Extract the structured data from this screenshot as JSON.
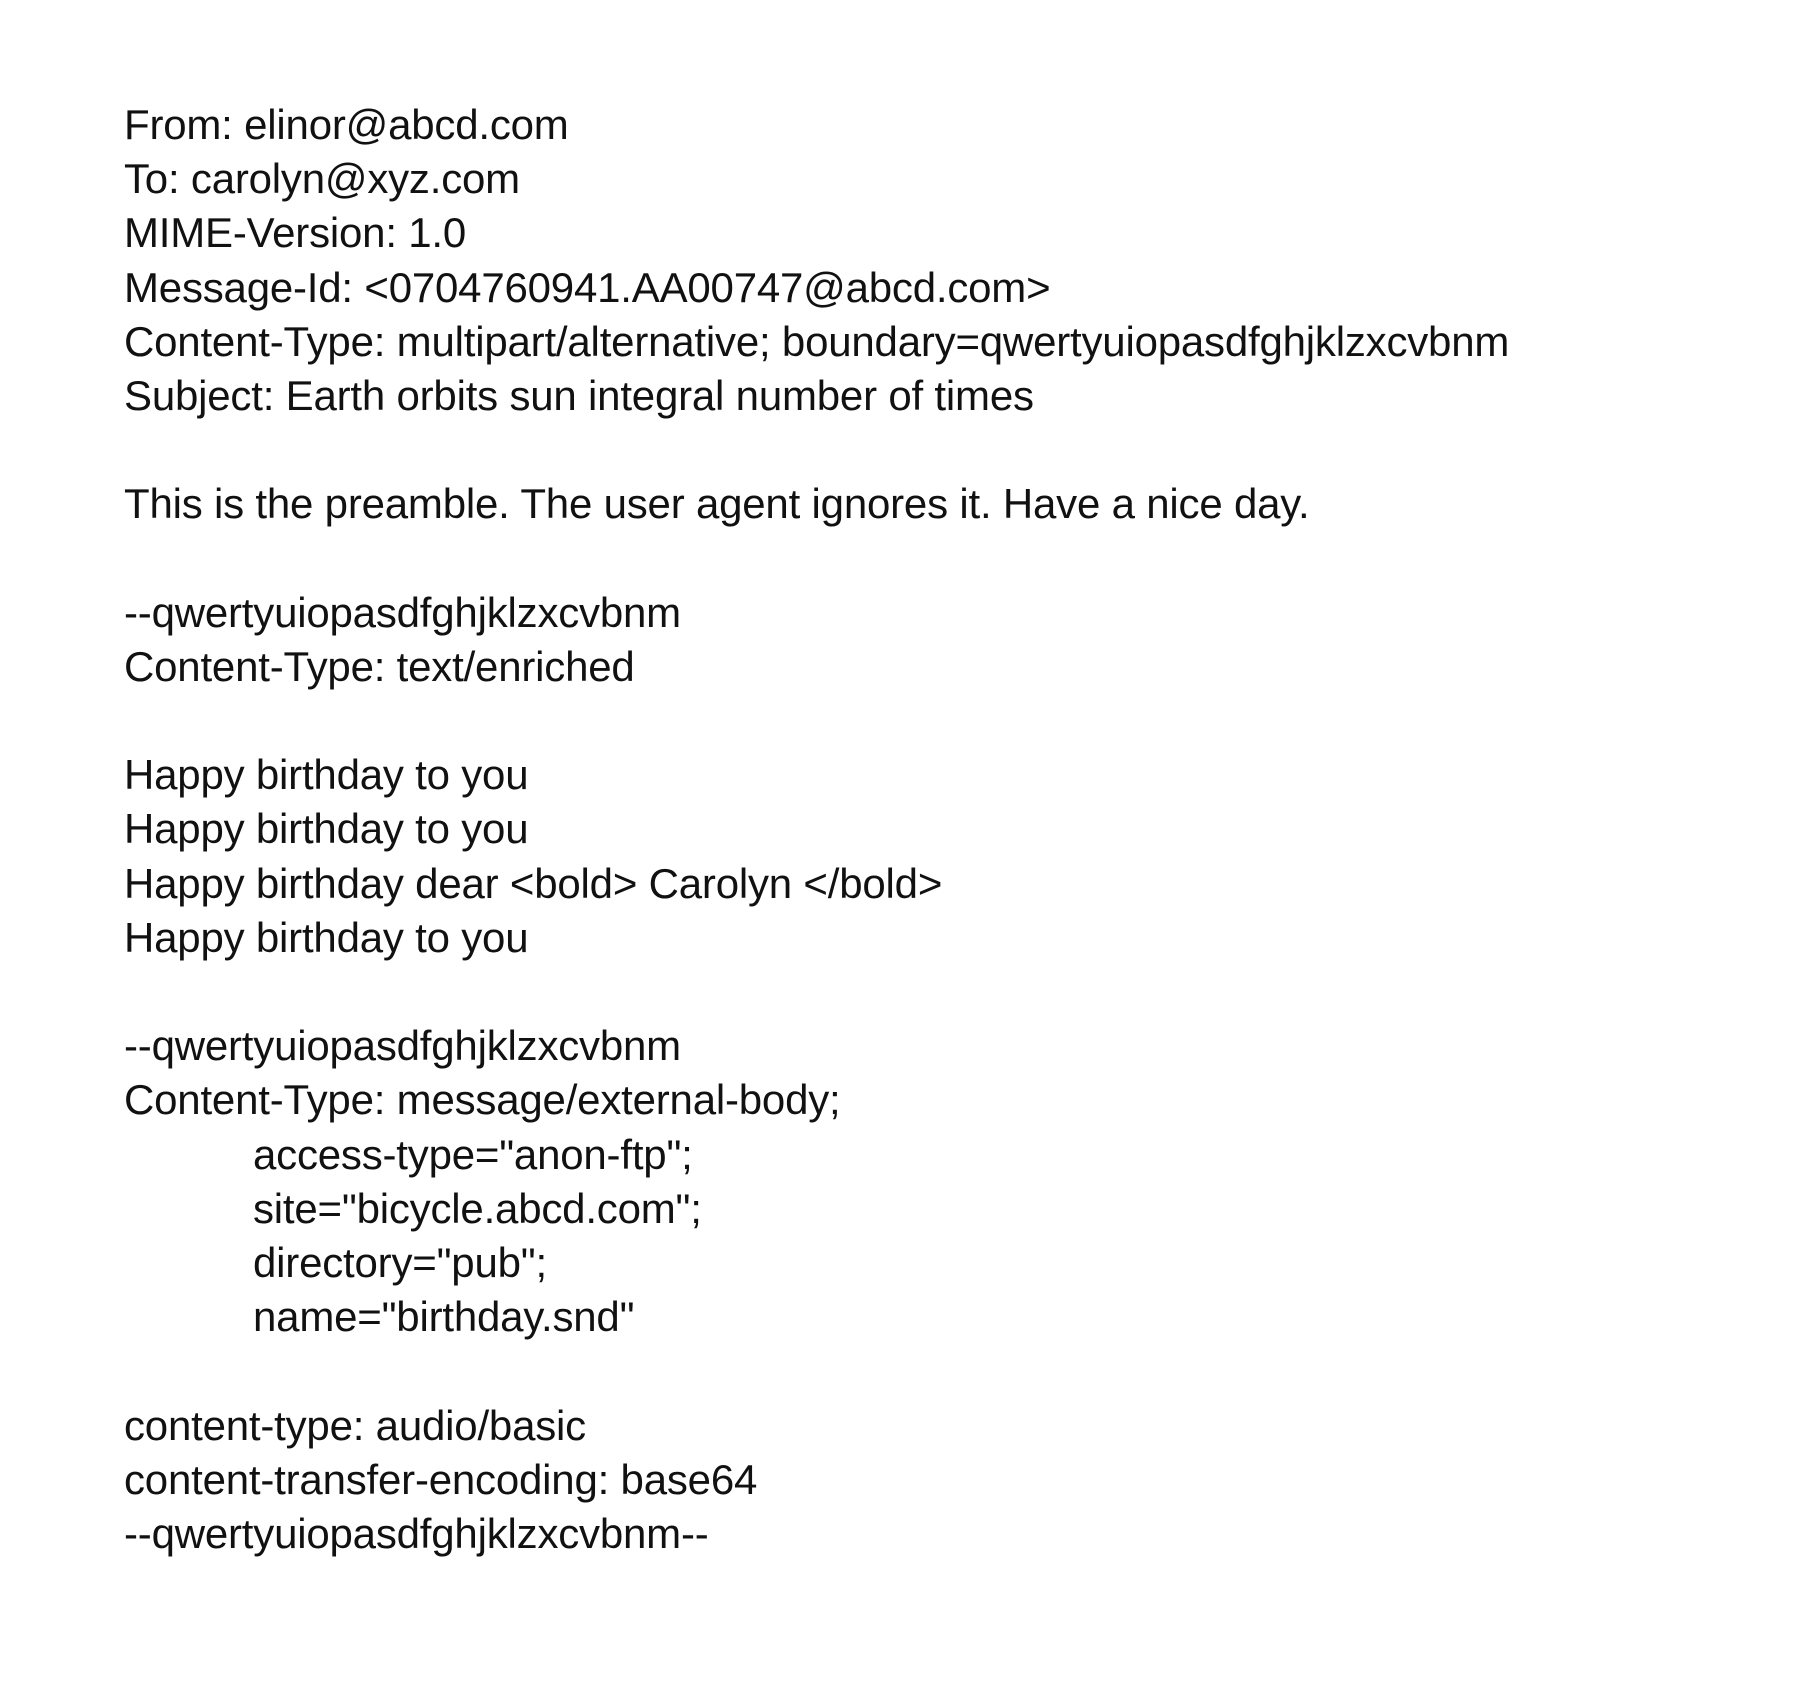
{
  "headers": [
    "From: elinor@abcd.com",
    "To: carolyn@xyz.com",
    "MIME-Version: 1.0",
    "Message-Id: <0704760941.AA00747@abcd.com>",
    "Content-Type: multipart/alternative; boundary=qwertyuiopasdfghjklzxcvbnm",
    "Subject: Earth orbits sun integral number of times"
  ],
  "preamble": "This is the preamble. The user agent ignores it. Have a nice day.",
  "part1": {
    "boundary": "--qwertyuiopasdfghjklzxcvbnm",
    "content_type": "Content-Type: text/enriched",
    "body": [
      "Happy birthday to you",
      "Happy birthday to you",
      "Happy birthday dear <bold> Carolyn </bold>",
      "Happy birthday to you"
    ]
  },
  "part2": {
    "boundary": "--qwertyuiopasdfghjklzxcvbnm",
    "content_type": "Content-Type: message/external-body;",
    "params": [
      "access-type=\"anon-ftp\";",
      "site=\"bicycle.abcd.com\";",
      "directory=\"pub\";",
      "name=\"birthday.snd\""
    ],
    "inner_headers": [
      "content-type: audio/basic",
      "content-transfer-encoding: base64"
    ],
    "closing_boundary": "--qwertyuiopasdfghjklzxcvbnm--"
  }
}
